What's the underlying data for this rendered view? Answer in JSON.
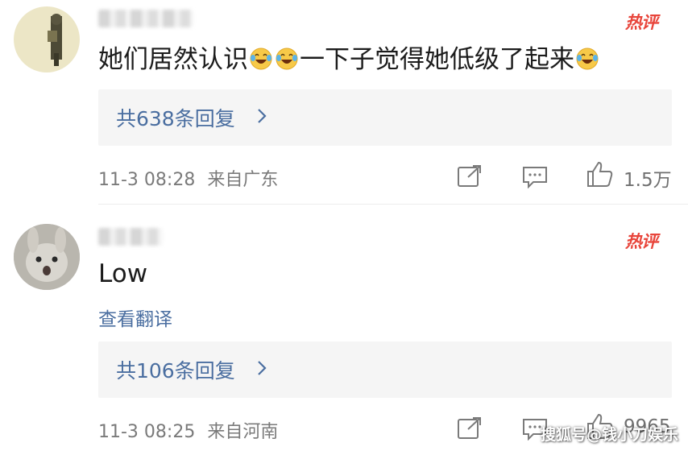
{
  "comments": [
    {
      "hot_badge": "热评",
      "text_part1": "她们居然认识",
      "text_part2": "一下子觉得她低级了起来",
      "replies_label": "共638条回复",
      "timestamp": "11-3 08:28",
      "location": "来自广东",
      "likes": "1.5万",
      "emoji": "laugh-cry-emoji"
    },
    {
      "hot_badge": "热评",
      "text": "Low",
      "translate_label": "查看翻译",
      "replies_label": "共106条回复",
      "timestamp": "11-3 08:25",
      "location": "来自河南",
      "likes": "9965"
    }
  ],
  "watermark": "搜狐号@钱小刀娱乐",
  "colors": {
    "link_blue": "#4a6ea0",
    "hot_red": "#e8443a",
    "meta_gray": "#7a7a7a",
    "reply_bg": "#f5f5f5"
  },
  "icons": [
    "share-icon",
    "comment-icon",
    "like-icon",
    "chevron-right-icon"
  ]
}
